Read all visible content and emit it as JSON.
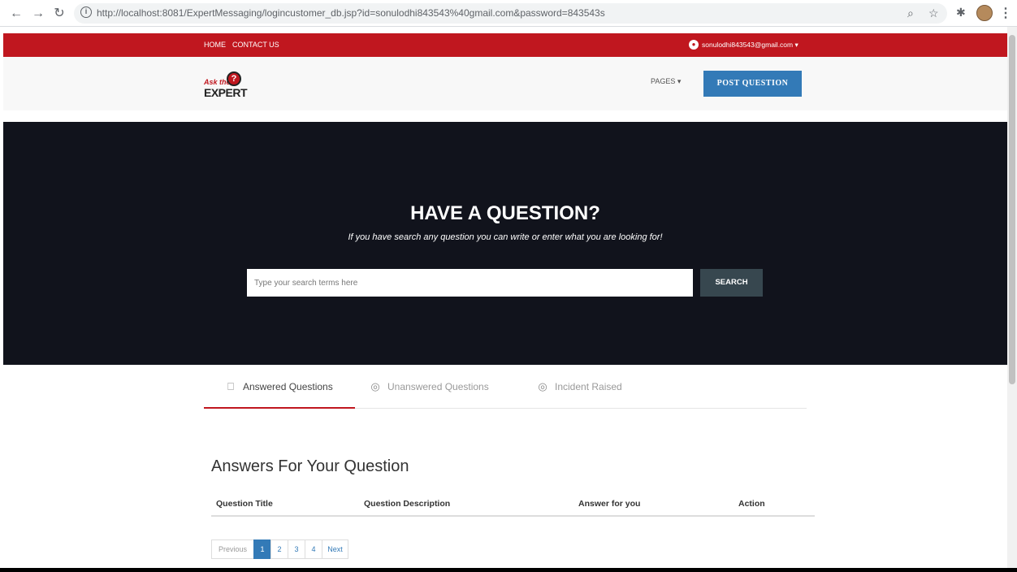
{
  "browser": {
    "url": "http://localhost:8081/ExpertMessaging/logincustomer_db.jsp?id=sonulodhi843543%40gmail.com&password=843543s"
  },
  "topbar": {
    "home": "HOME",
    "contact": "CONTACT US",
    "user_email": "sonulodhi843543@gmail.com ▾"
  },
  "header": {
    "logo_ask": "Ask the",
    "logo_q": "?",
    "logo_expert": "EXPERT",
    "pages": "PAGES ▾",
    "post_question": "POST QUESTION"
  },
  "hero": {
    "title": "HAVE A QUESTION?",
    "subtitle": "If you have search any question you can write or enter what you are looking for!",
    "search_placeholder": "Type your search terms here",
    "search_button": "SEARCH"
  },
  "tabs": [
    {
      "label": "Answered Questions",
      "icon": "bookmark-icon"
    },
    {
      "label": "Unanswered Questions",
      "icon": "layers-icon"
    },
    {
      "label": "Incident Raised",
      "icon": "layers-icon"
    }
  ],
  "answers": {
    "title": "Answers For Your Question",
    "columns": [
      "Question Title",
      "Question Description",
      "Answer for you",
      "Action"
    ]
  },
  "pagination": {
    "previous": "Previous",
    "pages": [
      "1",
      "2",
      "3",
      "4"
    ],
    "next": "Next",
    "active_page": "1"
  }
}
